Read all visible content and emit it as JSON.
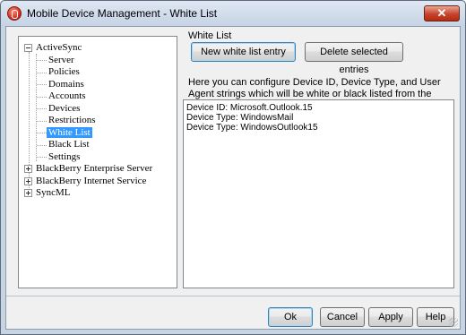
{
  "window": {
    "title": "Mobile Device Management - White List",
    "close_glyph": "✕"
  },
  "tree": {
    "items": [
      {
        "label": "ActiveSync",
        "expander": "minus"
      },
      {
        "label": "Server"
      },
      {
        "label": "Policies"
      },
      {
        "label": "Domains"
      },
      {
        "label": "Accounts"
      },
      {
        "label": "Devices"
      },
      {
        "label": "Restrictions"
      },
      {
        "label": "White List",
        "selected": true
      },
      {
        "label": "Black List"
      },
      {
        "label": "Settings"
      },
      {
        "label": "BlackBerry Enterprise Server",
        "expander": "plus"
      },
      {
        "label": "BlackBerry Internet Service",
        "expander": "plus"
      },
      {
        "label": "SyncML",
        "expander": "plus"
      }
    ]
  },
  "panel": {
    "group_label": "White List",
    "new_entry_button": "New white list entry",
    "delete_button": "Delete selected entries",
    "description": "Here you can configure Device ID, Device Type, and User Agent strings which will be white or black listed from the ActiveSync server.",
    "entries": [
      "Device ID: Microsoft.Outlook.15",
      "Device Type: WindowsMail",
      "Device Type: WindowsOutlook15"
    ]
  },
  "footer": {
    "ok": "Ok",
    "cancel": "Cancel",
    "apply": "Apply",
    "help": "Help"
  }
}
